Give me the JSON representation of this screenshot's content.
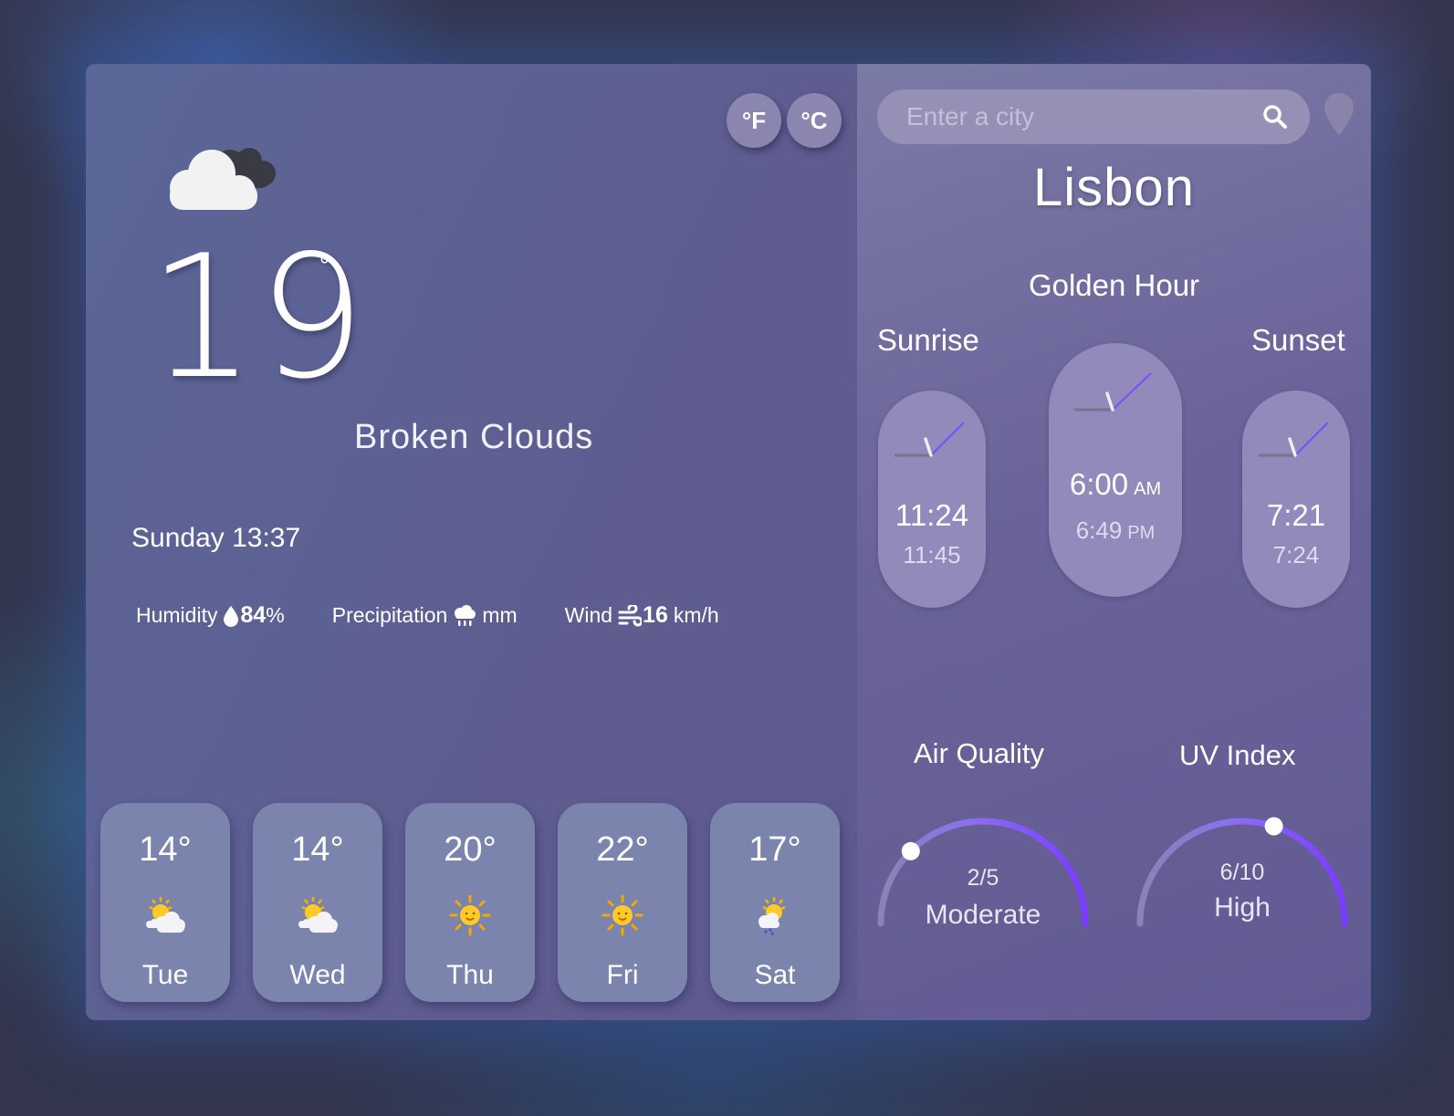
{
  "units": {
    "fahrenheit": "°F",
    "celsius": "°C"
  },
  "current": {
    "temperature": "19",
    "degree_symbol": "°",
    "description": "Broken Clouds",
    "datetime": "Sunday 13:37",
    "humidity_label": "Humidity",
    "humidity_value": "84",
    "humidity_unit": "%",
    "precipitation_label": "Precipitation",
    "precipitation_unit": "mm",
    "wind_label": "Wind",
    "wind_value": "16",
    "wind_unit": "km/h",
    "icon": "broken-clouds-icon"
  },
  "forecast": [
    {
      "temp": "14°",
      "day": "Tue",
      "icon": "sun-behind-cloud-icon"
    },
    {
      "temp": "14°",
      "day": "Wed",
      "icon": "sun-behind-cloud-icon"
    },
    {
      "temp": "20°",
      "day": "Thu",
      "icon": "sun-icon"
    },
    {
      "temp": "22°",
      "day": "Fri",
      "icon": "sun-icon"
    },
    {
      "temp": "17°",
      "day": "Sat",
      "icon": "sun-behind-rain-cloud-icon"
    }
  ],
  "search": {
    "placeholder": "Enter a city"
  },
  "city": "Lisbon",
  "golden_hour": {
    "title": "Golden Hour",
    "sunrise_label": "Sunrise",
    "sunset_label": "Sunset",
    "sunrise": {
      "start": "11:24",
      "end": "11:45"
    },
    "golden": {
      "start": "6:00",
      "start_suffix": "AM",
      "end": "6:49",
      "end_suffix": "PM"
    },
    "sunset": {
      "start": "7:21",
      "end": "7:24"
    }
  },
  "air_quality": {
    "title": "Air Quality",
    "value": "2/5",
    "label": "Moderate",
    "level": 0.25
  },
  "uv_index": {
    "title": "UV Index",
    "value": "6/10",
    "label": "High",
    "level": 0.6
  },
  "colors": {
    "accent": "#7a4dff",
    "panel": "#5e6292",
    "pill": "#918aba"
  }
}
